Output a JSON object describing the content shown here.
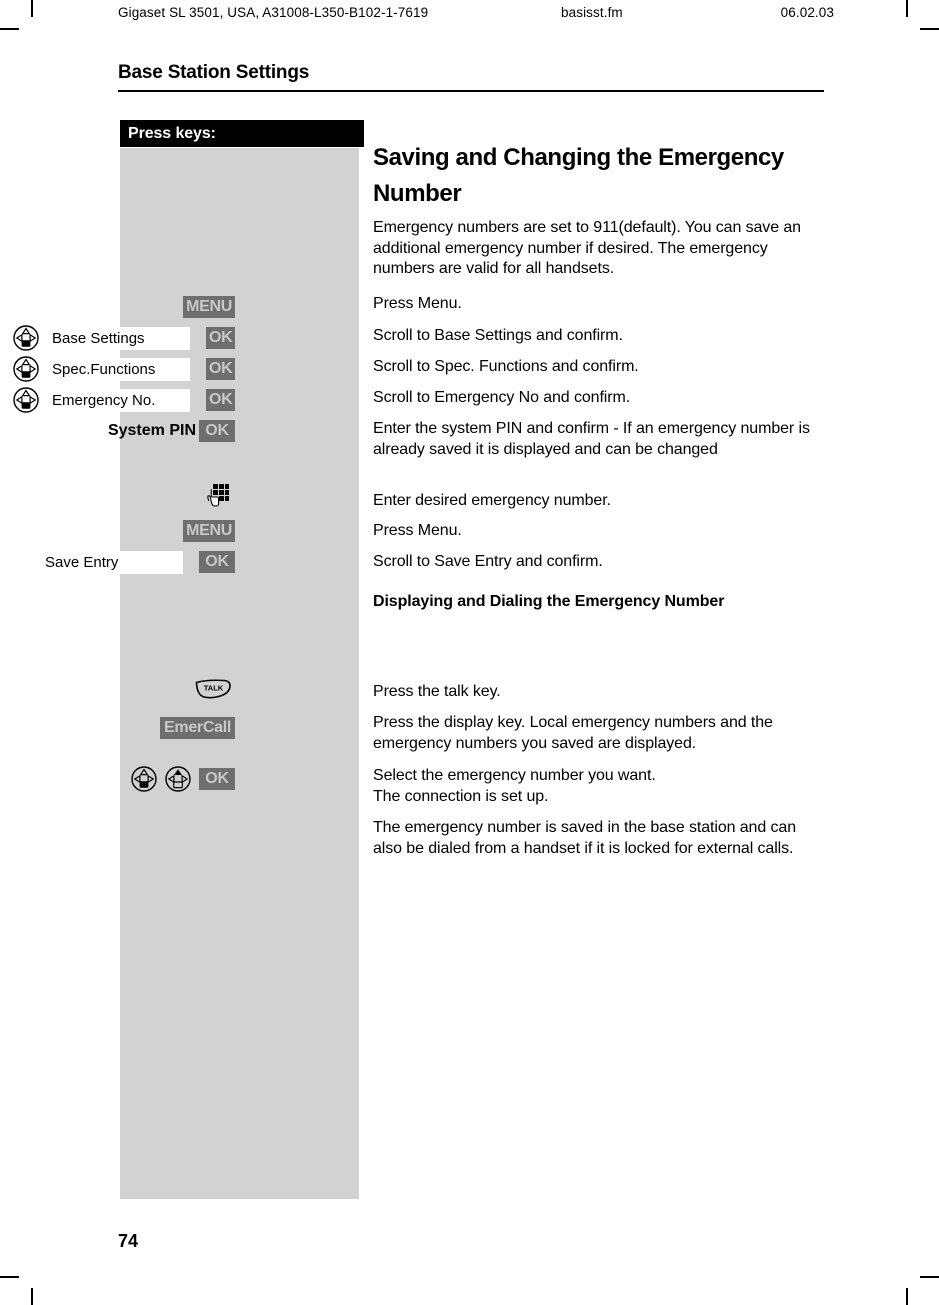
{
  "running_head": {
    "left": "Gigaset SL 3501, USA, A31008-L350-B102-1-7619",
    "center": "basisst.fm",
    "right": "06.02.03"
  },
  "chapter_title": "Base Station Settings",
  "keys_column": {
    "header": "Press keys:",
    "rows": [
      {
        "icon": null,
        "entry": null,
        "softkey": "MENU"
      },
      {
        "icon": "nav-key-icon",
        "entry": "Base Settings",
        "softkey": "OK"
      },
      {
        "icon": "nav-key-icon",
        "entry": "Spec.Functions",
        "softkey": "OK"
      },
      {
        "icon": "nav-key-icon",
        "entry": "Emergency No.",
        "softkey": "OK"
      },
      {
        "icon": null,
        "entry": "System PIN",
        "softkey": "OK"
      },
      {
        "icon": "keypad-icon",
        "entry": null,
        "softkey": null
      },
      {
        "icon": null,
        "entry": null,
        "softkey": "MENU"
      },
      {
        "icon": null,
        "entry": "Save Entry",
        "softkey": "OK"
      },
      {
        "icon": "talk-key-icon",
        "entry": null,
        "softkey": null
      },
      {
        "icon": null,
        "entry": null,
        "softkey": "EmerCall"
      },
      {
        "icon": "nav-key-icon",
        "entry": null,
        "softkey": "OK"
      }
    ],
    "talk_label": "TALK",
    "system_pin_label": "System PIN",
    "emercall_label": "EmerCall",
    "menu_label": "MENU",
    "ok_label": "OK"
  },
  "sections": [
    {
      "heading": "Saving and Changing the Emergency Number",
      "intro": "Emergency numbers are set to 911(default). You can save an additional emergency number if desired. The emergency numbers are valid for all handsets.",
      "steps": [
        "Press Menu.",
        "Scroll to Base Settings and confirm.",
        "Scroll to Spec. Functions and confirm.",
        "Scroll to Emergency No and confirm.",
        "Enter the system PIN and confirm - If an emergency number is already saved it is displayed and can be changed",
        "Enter desired emergency number.",
        "Press Menu.",
        "Scroll to Save Entry and confirm."
      ]
    },
    {
      "heading": "Displaying and Dialing the Emergency Number",
      "steps": [
        "Press the talk key.",
        "Press the display key. Local emergency numbers and the emergency numbers you saved are displayed.",
        "Select the emergency number you want.\nThe connection is set up.",
        "The emergency number is saved in the base station and can also be dialed from a handset if it is locked for external calls."
      ]
    }
  ],
  "page_number": "74",
  "colors": {
    "panel_gray": "#d2d2d2",
    "softkey_gray": "#6e6e6e",
    "softkey_text": "#c8c8c8",
    "header_black": "#000000"
  }
}
